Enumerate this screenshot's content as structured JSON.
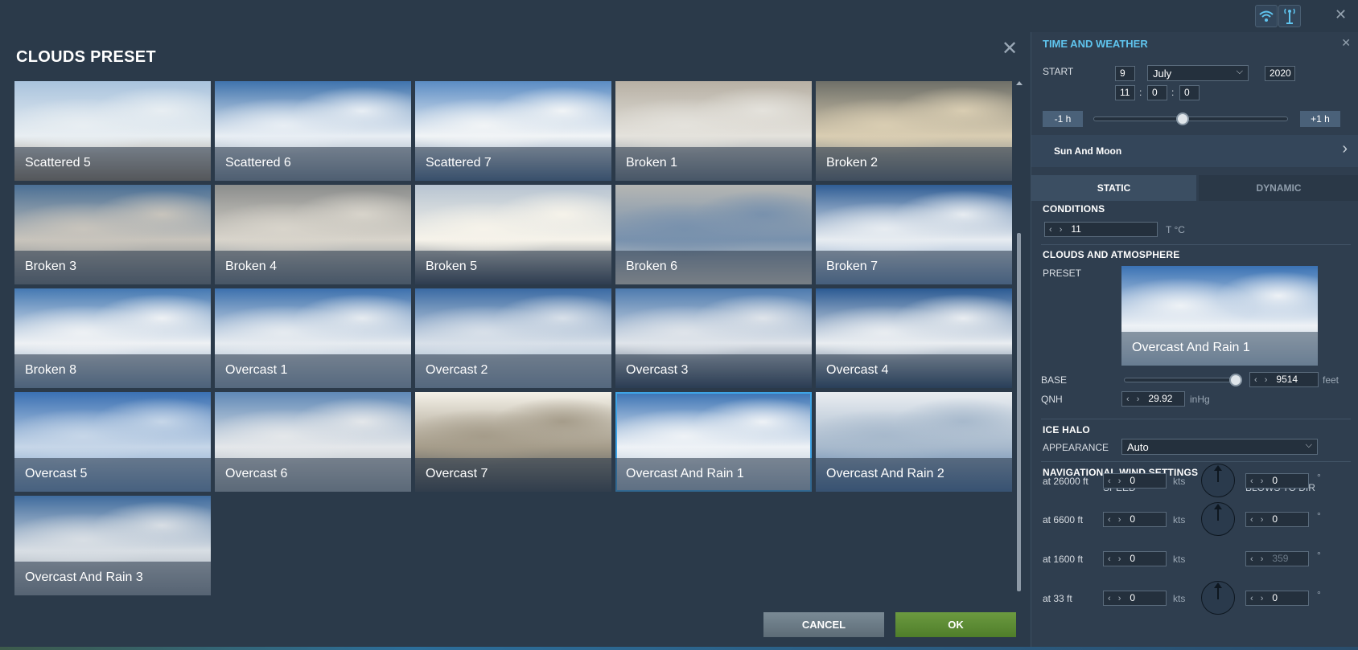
{
  "dialog": {
    "title": "CLOUDS PRESET",
    "close_icon": "close-icon",
    "presets": [
      {
        "label": "Scattered 5",
        "colors": [
          "#a9c3dd",
          "#e8eef2",
          "#8a7e70"
        ]
      },
      {
        "label": "Scattered 6",
        "colors": [
          "#3f73ad",
          "#e8eef4",
          "#7d8fa3"
        ]
      },
      {
        "label": "Scattered 7",
        "colors": [
          "#5b8cc4",
          "#f1f4f6",
          "#4c6e96"
        ]
      },
      {
        "label": "Broken 1",
        "colors": [
          "#b7b0a4",
          "#e4e2dc",
          "#6f7d8d"
        ]
      },
      {
        "label": "Broken 2",
        "colors": [
          "#6e6f68",
          "#d9cdb2",
          "#5c6a78"
        ]
      },
      {
        "label": "Broken 3",
        "colors": [
          "#4a6f95",
          "#c8c4bc",
          "#6b7783"
        ]
      },
      {
        "label": "Broken 4",
        "colors": [
          "#8b8d8c",
          "#d8d4cb",
          "#6d7c8b"
        ]
      },
      {
        "label": "Broken 5",
        "colors": [
          "#b7c4d1",
          "#f6f3ea",
          "#37465a"
        ]
      },
      {
        "label": "Broken 6",
        "colors": [
          "#b5b6b3",
          "#7891ad",
          "#dad7d0"
        ]
      },
      {
        "label": "Broken 7",
        "colors": [
          "#2f5d95",
          "#e7ecf1",
          "#6a8fbb"
        ]
      },
      {
        "label": "Broken 8",
        "colors": [
          "#4478b2",
          "#eef1f4",
          "#7a97b7"
        ]
      },
      {
        "label": "Overcast 1",
        "colors": [
          "#3c70ad",
          "#e6ebf0",
          "#8da6c1"
        ]
      },
      {
        "label": "Overcast 2",
        "colors": [
          "#3a6aa3",
          "#d8e0e9",
          "#8ba4bf"
        ]
      },
      {
        "label": "Overcast 3",
        "colors": [
          "#4d7aae",
          "#dfe4ea",
          "#2f4561"
        ]
      },
      {
        "label": "Overcast 4",
        "colors": [
          "#2b5a93",
          "#e9edf1",
          "#2b4a6d"
        ]
      },
      {
        "label": "Overcast 5",
        "colors": [
          "#3a70b3",
          "#c6d6e8",
          "#6d95c2"
        ]
      },
      {
        "label": "Overcast 6",
        "colors": [
          "#5f88b6",
          "#e4e7ea",
          "#9aa7b3"
        ]
      },
      {
        "label": "Overcast 7",
        "colors": [
          "#f4f1e8",
          "#a59c8a",
          "#3c4650"
        ]
      },
      {
        "label": "Overcast And Rain 1",
        "colors": [
          "#3a72b4",
          "#eef2f6",
          "#9fb4ca"
        ]
      },
      {
        "label": "Overcast And Rain 2",
        "colors": [
          "#e9edf1",
          "#a7b9cc",
          "#4b74a4"
        ]
      },
      {
        "label": "Overcast And Rain 3",
        "colors": [
          "#3f6b9d",
          "#d8dee4",
          "#8e9aa6"
        ]
      }
    ],
    "selected_index": 18,
    "cancel_label": "CANCEL",
    "ok_label": "OK"
  },
  "topbar": {
    "wifi_icon": "wifi-icon",
    "antenna_icon": "antenna-icon",
    "close_icon": "close-icon"
  },
  "panel": {
    "title": "TIME AND WEATHER",
    "start_label": "START",
    "day": "9",
    "month": "July",
    "year": "2020",
    "hour": "11",
    "minute": "0",
    "second": "0",
    "time_sep": ":",
    "minus_hour": "-1 h",
    "plus_hour": "+1 h",
    "time_slider_fraction": 0.46,
    "sun_moon": "Sun And Moon",
    "tab_static": "STATIC",
    "tab_dynamic": "DYNAMIC",
    "conditions": "CONDITIONS",
    "temperature": "11",
    "temperature_unit": "T °C",
    "clouds_section": "CLOUDS AND ATMOSPHERE",
    "preset_label": "PRESET",
    "preset_value": "Overcast And Rain 1",
    "base_label": "BASE",
    "base_value": "9514",
    "base_unit": "feet",
    "base_slider_fraction": 0.98,
    "qnh_label": "QNH",
    "qnh_value": "29.92",
    "qnh_unit": "inHg",
    "ice_halo": "ICE HALO",
    "appearance_label": "APPEARANCE",
    "appearance_value": "Auto",
    "wind_section": "NAVIGATIONAL WIND SETTINGS",
    "speed_header": "SPEED",
    "blows_header": "BLOWS TO DIR",
    "kts": "kts",
    "deg": "°",
    "winds": [
      {
        "alt": "at 26000 ft",
        "speed": "0",
        "dir": "0",
        "dir_enabled": true
      },
      {
        "alt": "at 6600 ft",
        "speed": "0",
        "dir": "0",
        "dir_enabled": true
      },
      {
        "alt": "at 1600 ft",
        "speed": "0",
        "dir": "359",
        "dir_enabled": false
      },
      {
        "alt": "at 33 ft",
        "speed": "0",
        "dir": "0",
        "dir_enabled": true
      }
    ]
  }
}
